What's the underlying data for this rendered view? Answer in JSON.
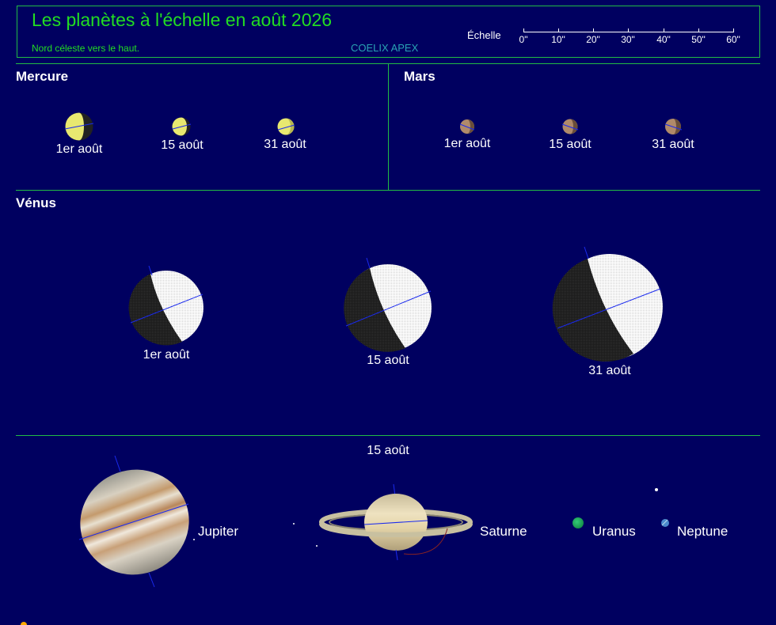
{
  "header": {
    "title": "Les planètes à l'échelle en août 2026",
    "subtitle": "Nord céleste vers le haut.",
    "brand": "COELIX APEX",
    "scale_label": "Échelle",
    "scale_ticks": [
      "0\"",
      "10\"",
      "20\"",
      "30\"",
      "40\"",
      "50\"",
      "60\""
    ]
  },
  "mercury": {
    "name": "Mercure",
    "dates": [
      "1er août",
      "15 août",
      "31 août"
    ]
  },
  "mars": {
    "name": "Mars",
    "dates": [
      "1er août",
      "15 août",
      "31 août"
    ]
  },
  "venus": {
    "name": "Vénus",
    "dates": [
      "1er août",
      "15 août",
      "31 août"
    ]
  },
  "outer": {
    "date": "15 août",
    "names": [
      "Jupiter",
      "Saturne",
      "Uranus",
      "Neptune"
    ]
  },
  "colors": {
    "background": "#000060",
    "frame": "#22bb44",
    "title": "#22dd22",
    "brand": "#29a3b3",
    "mercury": "#e8e870",
    "mars": "#b08a6a",
    "venus_lit": "#eeeeee",
    "venus_dark": "#222222",
    "uranus": "#22aa55",
    "neptune": "#4a8acc",
    "axis": "#1a2aee"
  },
  "icons": [
    "mercury-phase-icon",
    "mars-disk-icon",
    "venus-phase-icon",
    "jupiter-disk-icon",
    "saturn-ringed-icon",
    "uranus-disk-icon",
    "neptune-disk-icon"
  ]
}
